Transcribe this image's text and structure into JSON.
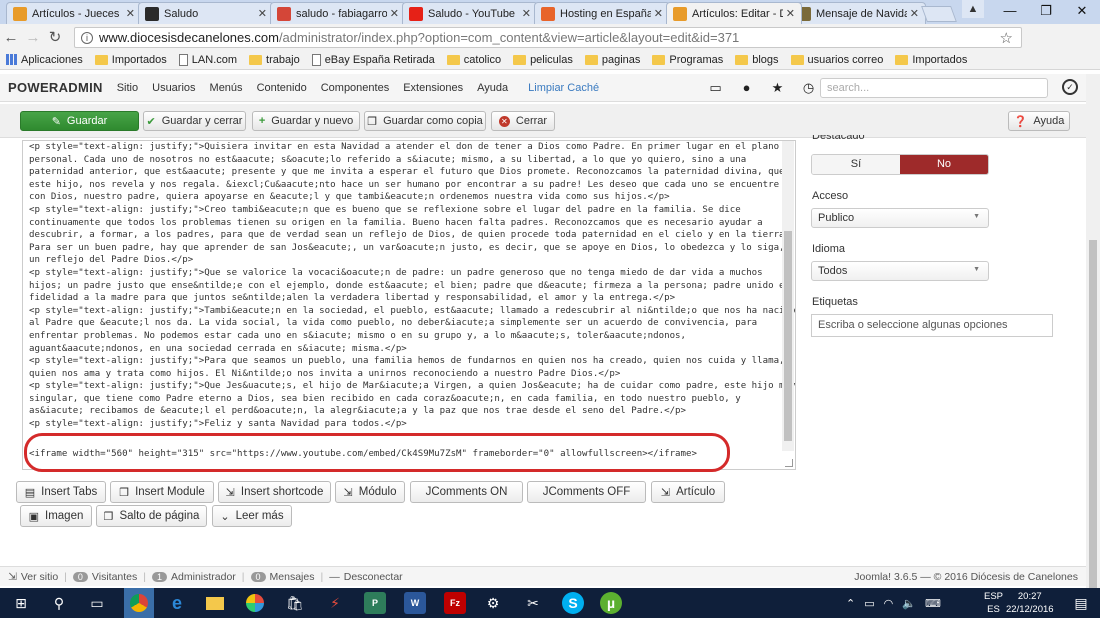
{
  "browser": {
    "tabs": [
      {
        "title": "Artículos - Jueces F",
        "favicon_color": "#e89b2a"
      },
      {
        "title": "Saludo",
        "favicon_color": "#2a2a2a"
      },
      {
        "title": "saludo - fabiagarro",
        "favicon_color": "#d44638"
      },
      {
        "title": "Saludo - YouTube",
        "favicon_color": "#e62117"
      },
      {
        "title": "Hosting en España",
        "favicon_color": "#e8642a"
      },
      {
        "title": "Artículos: Editar - D",
        "favicon_color": "#e89b2a"
      },
      {
        "title": "Mensaje de Navidad",
        "favicon_color": "#7a6a3a"
      }
    ],
    "tab_close": "✕",
    "window_buttons": [
      "—",
      "❐",
      "✕"
    ],
    "url_host": "www.diocesisdecanelones.com",
    "url_path": "/administrator/index.php?option=com_content&view=article&layout=edit&id=371",
    "bookmarks": [
      {
        "label": "Aplicaciones",
        "kind": "grid"
      },
      {
        "label": "Importados",
        "kind": "folder"
      },
      {
        "label": "LAN.com",
        "kind": "page"
      },
      {
        "label": "trabajo",
        "kind": "folder"
      },
      {
        "label": "eBay España Retirada",
        "kind": "page"
      },
      {
        "label": "catolico",
        "kind": "folder"
      },
      {
        "label": "peliculas",
        "kind": "folder"
      },
      {
        "label": "paginas",
        "kind": "folder"
      },
      {
        "label": "Programas",
        "kind": "folder"
      },
      {
        "label": "blogs",
        "kind": "folder"
      },
      {
        "label": "usuarios correo",
        "kind": "folder"
      },
      {
        "label": "Importados",
        "kind": "folder"
      }
    ]
  },
  "admin": {
    "brand": "POWERADMIN",
    "menu": [
      "Sitio",
      "Usuarios",
      "Menús",
      "Contenido",
      "Componentes",
      "Extensiones",
      "Ayuda"
    ],
    "clear_cache": "Limpiar Caché",
    "search_placeholder": "search..."
  },
  "toolbar": {
    "save": "Guardar",
    "save_close": "Guardar y cerrar",
    "save_new": "Guardar y nuevo",
    "save_copy": "Guardar como copia",
    "close": "Cerrar",
    "help": "Ayuda"
  },
  "editor": {
    "lines": [
      "<p style=\"text-align: justify;\">Quisiera invitar en esta Navidad a atender el don de tener a Dios como Padre. En primer lugar en el plano",
      "personal. Cada uno de nosotros no est&aacute; s&oacute;lo referido a s&iacute; mismo, a su libertad, a lo que yo quiero, sino a una",
      "paternidad anterior, que est&aacute; presente y que me invita a esperar el futuro que Dios promete. Reconozcamos la paternidad divina, que",
      "este hijo, nos revela y nos regala. &iexcl;Cu&aacute;nto hace un ser humano por encontrar a su padre! Les deseo que cada uno se encuentre",
      "con Dios, nuestro padre, quiera apoyarse en &eacute;l y que tambi&eacute;n ordenemos nuestra vida como sus hijos.</p>",
      "<p style=\"text-align: justify;\">Creo tambi&eacute;n que es bueno que se reflexione sobre el lugar del padre en la familia. Se dice",
      "continuamente que todos los problemas tienen su origen en la familia. Bueno hacen falta padres. Reconozcamos que es necesario ayudar a",
      "descubrir, a formar, a los padres, para que de verdad sean un reflejo de Dios, de quien procede toda paternidad en el cielo y en la tierra.",
      "Para ser un buen padre, hay que aprender de san Jos&eacute;, un var&oacute;n justo, es decir, que se apoye en Dios, lo obedezca y lo siga,",
      "un reflejo del Padre Dios.</p>",
      "<p style=\"text-align: justify;\">Que se valorice la vocaci&oacute;n de padre: un padre generoso que no tenga miedo de dar vida a muchos",
      "hijos; un padre justo que ense&ntilde;e con el ejemplo, donde est&aacute; el bien; padre que d&eacute; firmeza a la persona; padre unido en",
      "fidelidad a la madre para que juntos se&ntilde;alen la verdadera libertad y responsabilidad, el amor y la entrega.</p>",
      "<p style=\"text-align: justify;\">Tambi&eacute;n en la sociedad, el pueblo, est&aacute; llamado a redescubrir al ni&ntilde;o que nos ha nacido y",
      "al Padre que &eacute;l nos da. La vida social, la vida como pueblo, no deber&iacute;a simplemente ser un acuerdo de convivencia, para",
      "enfrentar problemas. No podemos estar cada uno en s&iacute; mismo o en su grupo y, a lo m&aacute;s, toler&aacute;ndonos,",
      "aguant&aacute;ndonos, en una sociedad cerrada en s&iacute; misma.</p>",
      "<p style=\"text-align: justify;\">Para que seamos un pueblo, una familia hemos de fundarnos en quien nos ha creado, quien nos cuida y llama,",
      "quien nos ama y trata como hijos. El Ni&ntilde;o nos invita a unirnos reconociendo a nuestro Padre Dios.</p>",
      "<p style=\"text-align: justify;\">Que Jes&uacute;s, el hijo de Mar&iacute;a Virgen, a quien Jos&eacute; ha de cuidar como padre, este hijo muy",
      "singular, que tiene como Padre eterno a Dios, sea bien recibido en cada coraz&oacute;n, en cada familia, en todo nuestro pueblo, y",
      "as&iacute; recibamos de &eacute;l el perd&oacute;n, la alegr&iacute;a y la paz que nos trae desde el seno del Padre.</p>",
      "<p style=\"text-align: justify;\">Feliz y santa Navidad para todos.</p>"
    ],
    "iframe_line": "<iframe width=\"560\" height=\"315\" src=\"https://www.youtube.com/embed/Ck4S9Mu7ZsM\" frameborder=\"0\" allowfullscreen></iframe>"
  },
  "editor_buttons": {
    "insert_tabs": "Insert Tabs",
    "insert_module": "Insert Module",
    "insert_shortcode": "Insert shortcode",
    "modulo": "Módulo",
    "jcomments_on": "JComments ON",
    "jcomments_off": "JComments OFF",
    "articulo": "Artículo",
    "imagen": "Imagen",
    "salto": "Salto de página",
    "leer_mas": "Leer más"
  },
  "sidebar": {
    "destacado_label": "Destacado",
    "si": "Sí",
    "no": "No",
    "acceso_label": "Acceso",
    "acceso_value": "Publico",
    "idioma_label": "Idioma",
    "idioma_value": "Todos",
    "etiquetas_label": "Etiquetas",
    "etiquetas_placeholder": "Escriba o seleccione algunas opciones"
  },
  "status": {
    "ver_sitio": "Ver sitio",
    "visitantes_count": "0",
    "visitantes": "Visitantes",
    "admin_count": "1",
    "administrador": "Administrador",
    "mensajes_count": "0",
    "mensajes": "Mensajes",
    "desconectar": "Desconectar",
    "version": "Joomla! 3.6.5 — © 2016 Diócesis de Canelones"
  },
  "taskbar": {
    "lang_1": "ESP",
    "lang_2": "ES",
    "time": "20:27",
    "date": "22/12/2016"
  },
  "colors": {
    "save_green": "#3a983a",
    "no_red": "#9e2a2a",
    "highlight_red": "#d42a2a",
    "taskbar": "#0f1f3a"
  }
}
